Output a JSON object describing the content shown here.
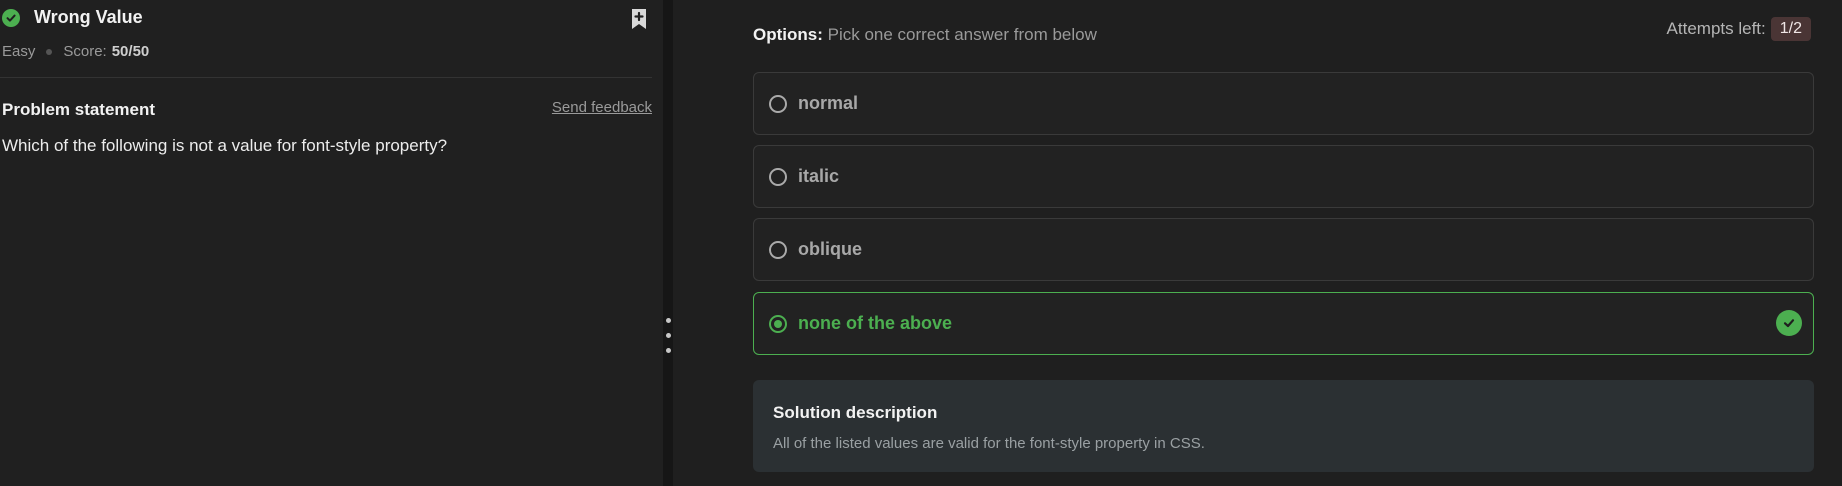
{
  "problem": {
    "title": "Wrong Value",
    "difficulty": "Easy",
    "score_label": "Score:",
    "score_value": "50/50",
    "statement_heading": "Problem statement",
    "feedback_link": "Send feedback",
    "statement_text": "Which of the following is not a value for font-style property?"
  },
  "options_panel": {
    "header_bold": "Options:",
    "header_text": " Pick one correct answer from below",
    "attempts_label": "Attempts left:",
    "attempts_value": "1/2",
    "options": [
      {
        "label": "normal",
        "selected": false
      },
      {
        "label": "italic",
        "selected": false
      },
      {
        "label": "oblique",
        "selected": false
      },
      {
        "label": "none of the above",
        "selected": true
      }
    ]
  },
  "solution": {
    "title": "Solution description",
    "text": "All of the listed values are valid for the font-style property in CSS."
  },
  "colors": {
    "success": "#4caf50",
    "background": "#1f1f1f",
    "panel": "#202020",
    "solution_bg": "#2b3033",
    "attempts_badge_bg": "#4a3535"
  },
  "icons": {
    "solved": "check-circle-icon",
    "bookmark": "bookmark-add-icon",
    "correct_option": "check-circle-icon",
    "splitter": "vertical-grip-icon"
  }
}
